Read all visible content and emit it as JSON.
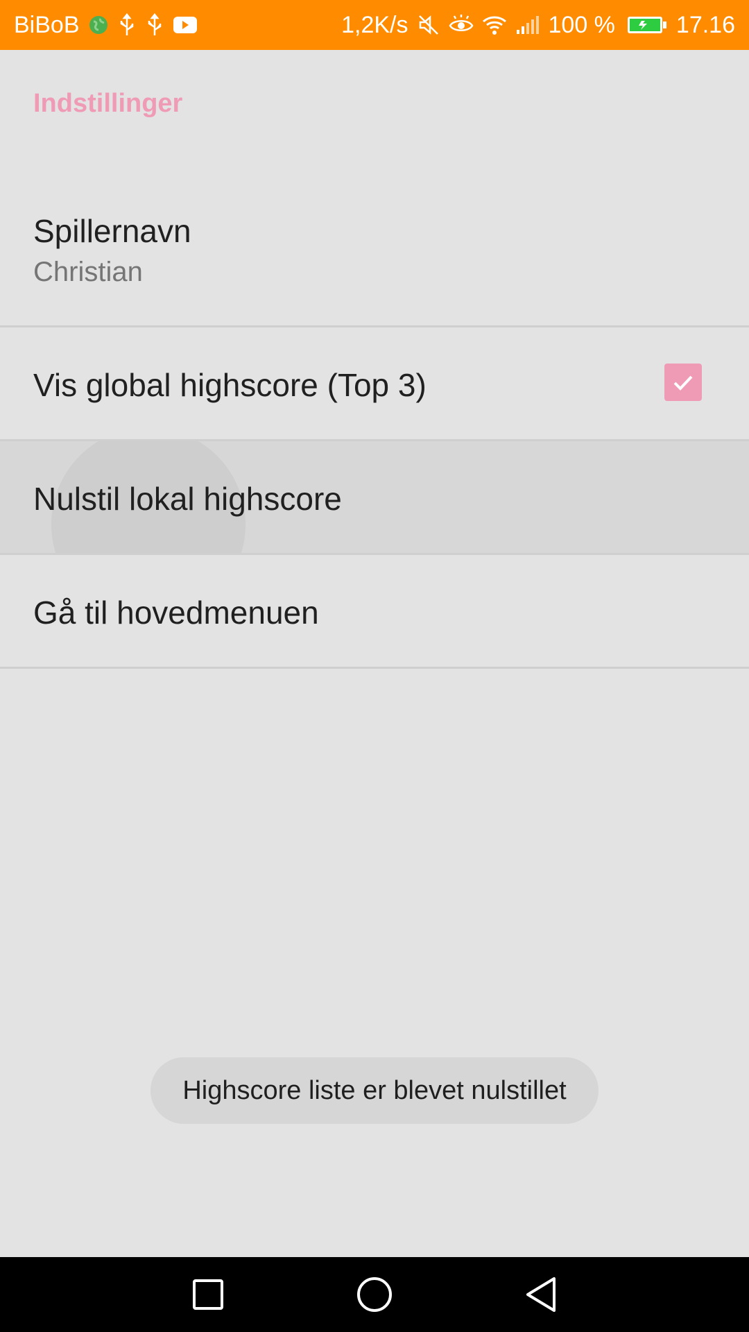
{
  "status_bar": {
    "carrier": "BiBoB",
    "speed": "1,2K/s",
    "battery": "100 %",
    "time": "17.16",
    "icons_left": [
      "globe-icon",
      "usb-icon",
      "usb-icon",
      "youtube-icon"
    ],
    "icons_right": [
      "mute-icon",
      "eye-icon",
      "wifi-icon",
      "signal-icon",
      "battery-charging-icon"
    ],
    "color": "#ff8c00"
  },
  "settings": {
    "section_header": "Indstillinger",
    "player_name": {
      "title": "Spillernavn",
      "value": "Christian"
    },
    "global_highscore": {
      "title": "Vis global highscore (Top 3)",
      "checked": true
    },
    "reset_local": {
      "title": "Nulstil lokal highscore"
    },
    "main_menu": {
      "title": "Gå til hovedmenuen"
    },
    "accent_color": "#f09bb6"
  },
  "toast": {
    "message": "Highscore liste er blevet nulstillet"
  },
  "nav_bar": {
    "buttons": [
      "recent-apps-button",
      "home-button",
      "back-button"
    ]
  }
}
